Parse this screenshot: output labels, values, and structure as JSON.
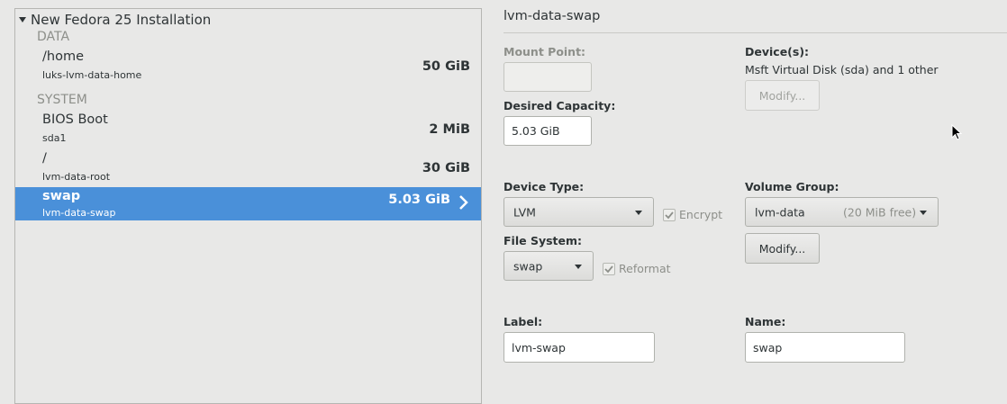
{
  "tree": {
    "header": "New Fedora 25 Installation",
    "groups": [
      {
        "label": "DATA",
        "items": [
          {
            "name": "/home",
            "sub": "luks-lvm-data-home",
            "size": "50 GiB"
          }
        ]
      },
      {
        "label": "SYSTEM",
        "items": [
          {
            "name": "BIOS Boot",
            "sub": "sda1",
            "size": "2 MiB"
          },
          {
            "name": "/",
            "sub": "lvm-data-root",
            "size": "30 GiB"
          },
          {
            "name": "swap",
            "sub": "lvm-data-swap",
            "size": "5.03 GiB",
            "selected": true
          }
        ]
      }
    ]
  },
  "details": {
    "title": "lvm-data-swap",
    "mount_point_label": "Mount Point:",
    "mount_point_value": "",
    "desired_capacity_label": "Desired Capacity:",
    "desired_capacity_value": "5.03 GiB",
    "devices_label": "Device(s):",
    "devices_value": "Msft Virtual Disk (sda) and 1 other",
    "devices_modify": "Modify...",
    "device_type_label": "Device Type:",
    "device_type_value": "LVM",
    "encrypt_label": "Encrypt",
    "encrypt_checked": true,
    "volume_group_label": "Volume Group:",
    "volume_group_value": "lvm-data",
    "volume_group_free": "(20 MiB free)",
    "volume_group_modify": "Modify...",
    "file_system_label": "File System:",
    "file_system_value": "swap",
    "reformat_label": "Reformat",
    "reformat_checked": true,
    "label_label": "Label:",
    "label_value": "lvm-swap",
    "name_label": "Name:",
    "name_value": "swap"
  },
  "colors": {
    "selection": "#4a90d9",
    "background": "#e8e8e7"
  }
}
